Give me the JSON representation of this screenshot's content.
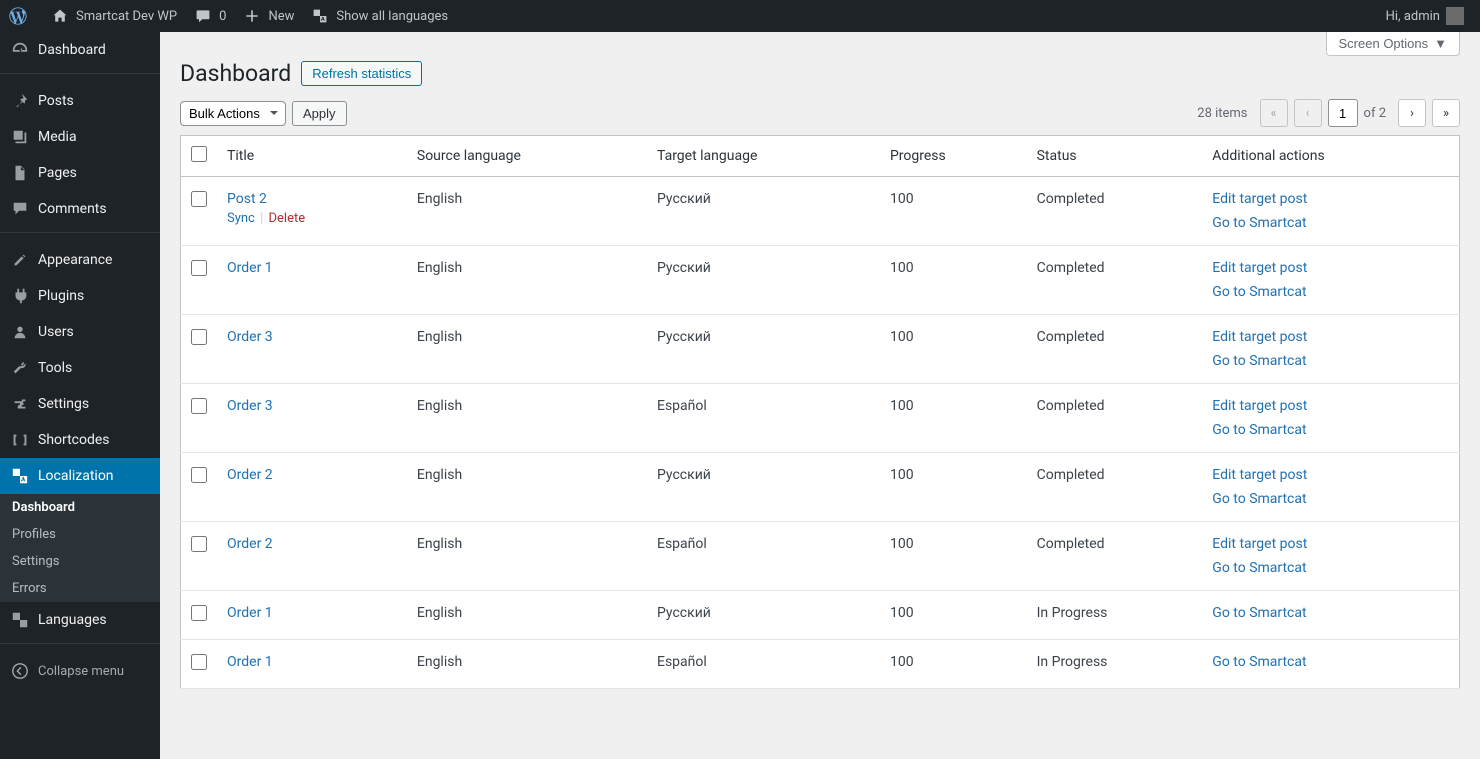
{
  "adminbar": {
    "site_name": "Smartcat Dev WP",
    "comments_count": "0",
    "new_label": "New",
    "show_languages_label": "Show all languages",
    "greeting": "Hi, admin"
  },
  "sidebar": {
    "items": [
      {
        "label": "Dashboard",
        "icon": "dashboard"
      },
      {
        "label": "Posts",
        "icon": "pin"
      },
      {
        "label": "Media",
        "icon": "media"
      },
      {
        "label": "Pages",
        "icon": "pages"
      },
      {
        "label": "Comments",
        "icon": "comments"
      },
      {
        "label": "Appearance",
        "icon": "appearance"
      },
      {
        "label": "Plugins",
        "icon": "plugins"
      },
      {
        "label": "Users",
        "icon": "users"
      },
      {
        "label": "Tools",
        "icon": "tools"
      },
      {
        "label": "Settings",
        "icon": "settings"
      },
      {
        "label": "Shortcodes",
        "icon": "shortcodes"
      },
      {
        "label": "Localization",
        "icon": "localization"
      },
      {
        "label": "Languages",
        "icon": "languages"
      }
    ],
    "submenu": [
      {
        "label": "Dashboard"
      },
      {
        "label": "Profiles"
      },
      {
        "label": "Settings"
      },
      {
        "label": "Errors"
      }
    ],
    "collapse_label": "Collapse menu"
  },
  "screen_options_label": "Screen Options",
  "page_title": "Dashboard",
  "refresh_label": "Refresh statistics",
  "bulk_actions_label": "Bulk Actions",
  "apply_label": "Apply",
  "pagination": {
    "total_text": "28 items",
    "current_page": "1",
    "of_label": "of 2"
  },
  "table": {
    "headers": {
      "title": "Title",
      "source": "Source language",
      "target": "Target language",
      "progress": "Progress",
      "status": "Status",
      "actions": "Additional actions"
    },
    "row_action_labels": {
      "sync": "Sync",
      "delete": "Delete",
      "edit_target": "Edit target post",
      "go_smartcat": "Go to Smartcat"
    },
    "rows": [
      {
        "title": "Post 2",
        "source": "English",
        "target": "Русский",
        "progress": "100",
        "status": "Completed",
        "show_row_actions": true,
        "show_edit": true
      },
      {
        "title": "Order 1",
        "source": "English",
        "target": "Русский",
        "progress": "100",
        "status": "Completed",
        "show_row_actions": false,
        "show_edit": true
      },
      {
        "title": "Order 3",
        "source": "English",
        "target": "Русский",
        "progress": "100",
        "status": "Completed",
        "show_row_actions": false,
        "show_edit": true
      },
      {
        "title": "Order 3",
        "source": "English",
        "target": "Español",
        "progress": "100",
        "status": "Completed",
        "show_row_actions": false,
        "show_edit": true
      },
      {
        "title": "Order 2",
        "source": "English",
        "target": "Русский",
        "progress": "100",
        "status": "Completed",
        "show_row_actions": false,
        "show_edit": true
      },
      {
        "title": "Order 2",
        "source": "English",
        "target": "Español",
        "progress": "100",
        "status": "Completed",
        "show_row_actions": false,
        "show_edit": true
      },
      {
        "title": "Order 1",
        "source": "English",
        "target": "Русский",
        "progress": "100",
        "status": "In Progress",
        "show_row_actions": false,
        "show_edit": false
      },
      {
        "title": "Order 1",
        "source": "English",
        "target": "Español",
        "progress": "100",
        "status": "In Progress",
        "show_row_actions": false,
        "show_edit": false
      }
    ]
  }
}
